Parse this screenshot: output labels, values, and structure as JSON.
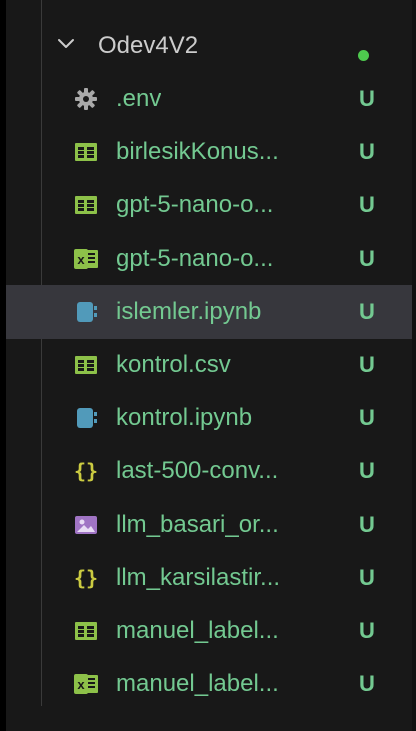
{
  "folder": {
    "name": "Odev4V2",
    "status_color": "#4ec94e"
  },
  "colors": {
    "untracked_text": "#73c991",
    "selected_row_bg": "#37373d",
    "panel_bg": "#181818"
  },
  "files": [
    {
      "name": ".env",
      "status": "U",
      "icon": "gear-icon"
    },
    {
      "name": "birlesikKonus...",
      "status": "U",
      "icon": "table-icon"
    },
    {
      "name": "gpt-5-nano-o...",
      "status": "U",
      "icon": "table-icon"
    },
    {
      "name": "gpt-5-nano-o...",
      "status": "U",
      "icon": "excel-icon"
    },
    {
      "name": "islemler.ipynb",
      "status": "U",
      "icon": "notebook-icon",
      "selected": true
    },
    {
      "name": "kontrol.csv",
      "status": "U",
      "icon": "table-icon"
    },
    {
      "name": "kontrol.ipynb",
      "status": "U",
      "icon": "notebook-icon"
    },
    {
      "name": "last-500-conv...",
      "status": "U",
      "icon": "json-icon"
    },
    {
      "name": "llm_basari_or...",
      "status": "U",
      "icon": "image-icon"
    },
    {
      "name": "llm_karsilastir...",
      "status": "U",
      "icon": "json-icon"
    },
    {
      "name": "manuel_label...",
      "status": "U",
      "icon": "table-icon"
    },
    {
      "name": "manuel_label...",
      "status": "U",
      "icon": "excel-icon"
    }
  ]
}
